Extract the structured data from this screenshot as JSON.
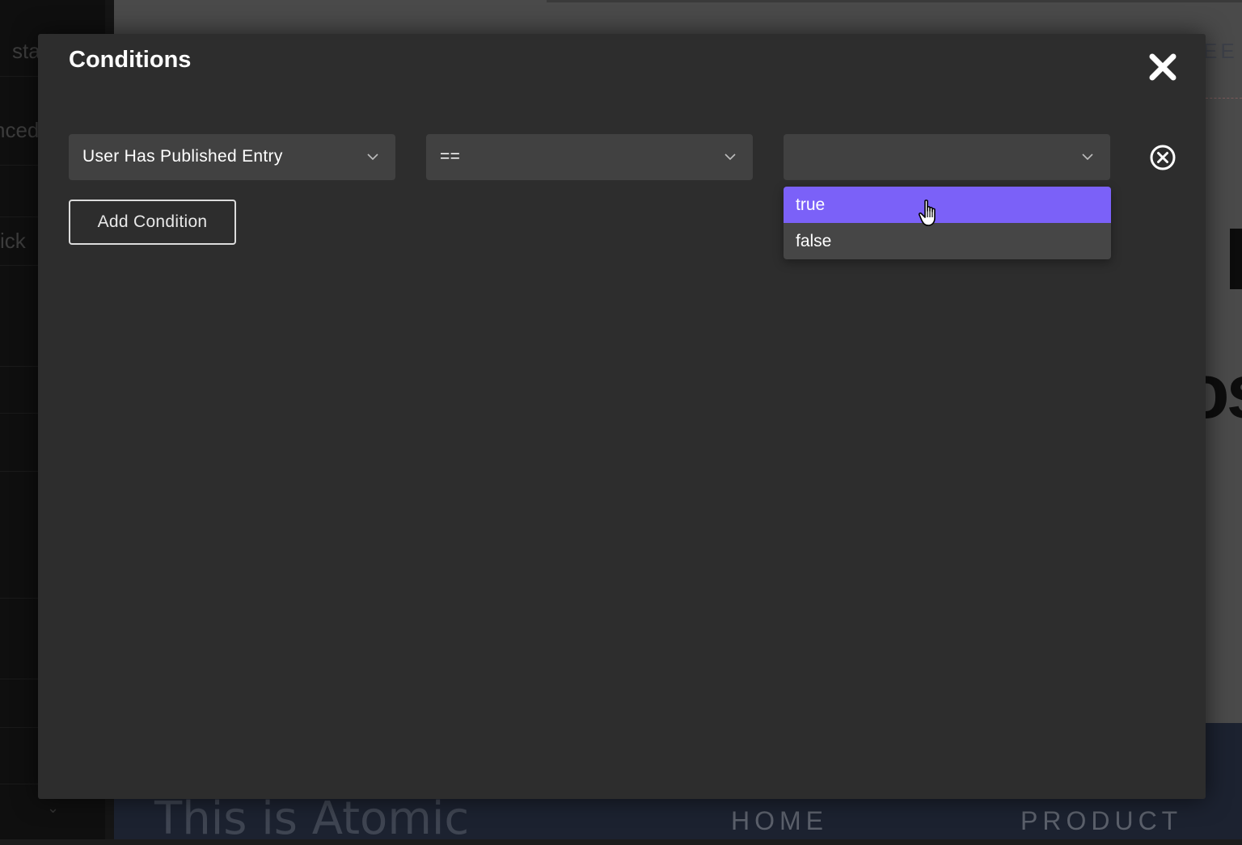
{
  "background": {
    "sidebar_fragments": [
      "sta",
      "nced",
      "ick"
    ],
    "canvas_fragment_top_right": "EE",
    "canvas_fragment_big": "os",
    "footer": {
      "brand": "This is Atomic",
      "nav": [
        "HOME",
        "PRODUCT"
      ]
    }
  },
  "modal": {
    "title": "Conditions",
    "close_icon": "close-icon",
    "condition": {
      "field_value": "User Has Published Entry",
      "operator_value": "==",
      "comparison_value": "",
      "remove_icon": "remove-circle-icon"
    },
    "add_condition_label": "Add Condition",
    "dropdown_options": [
      "true",
      "false"
    ],
    "highlighted_option": "true"
  },
  "colors": {
    "accent": "#7b61f8",
    "modal_bg": "#2d2d2d",
    "select_bg": "#414141"
  }
}
